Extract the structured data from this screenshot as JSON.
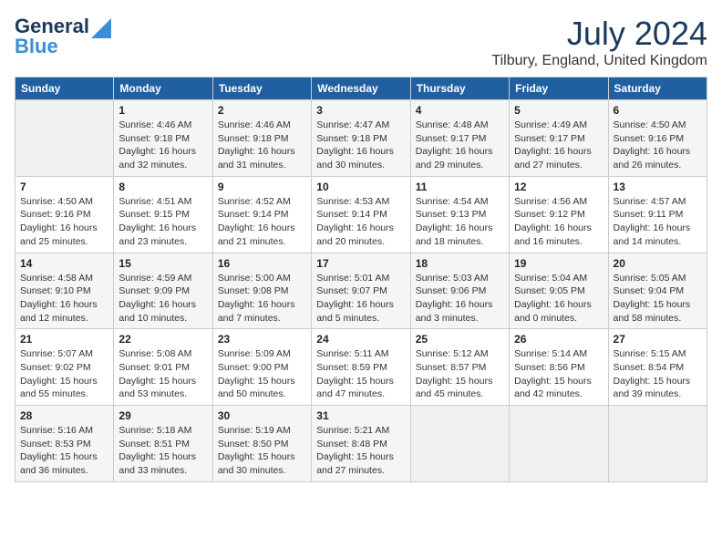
{
  "header": {
    "logo_line1": "General",
    "logo_line2": "Blue",
    "month_year": "July 2024",
    "location": "Tilbury, England, United Kingdom"
  },
  "days_of_week": [
    "Sunday",
    "Monday",
    "Tuesday",
    "Wednesday",
    "Thursday",
    "Friday",
    "Saturday"
  ],
  "weeks": [
    [
      {
        "day": "",
        "info": ""
      },
      {
        "day": "1",
        "info": "Sunrise: 4:46 AM\nSunset: 9:18 PM\nDaylight: 16 hours\nand 32 minutes."
      },
      {
        "day": "2",
        "info": "Sunrise: 4:46 AM\nSunset: 9:18 PM\nDaylight: 16 hours\nand 31 minutes."
      },
      {
        "day": "3",
        "info": "Sunrise: 4:47 AM\nSunset: 9:18 PM\nDaylight: 16 hours\nand 30 minutes."
      },
      {
        "day": "4",
        "info": "Sunrise: 4:48 AM\nSunset: 9:17 PM\nDaylight: 16 hours\nand 29 minutes."
      },
      {
        "day": "5",
        "info": "Sunrise: 4:49 AM\nSunset: 9:17 PM\nDaylight: 16 hours\nand 27 minutes."
      },
      {
        "day": "6",
        "info": "Sunrise: 4:50 AM\nSunset: 9:16 PM\nDaylight: 16 hours\nand 26 minutes."
      }
    ],
    [
      {
        "day": "7",
        "info": "Sunrise: 4:50 AM\nSunset: 9:16 PM\nDaylight: 16 hours\nand 25 minutes."
      },
      {
        "day": "8",
        "info": "Sunrise: 4:51 AM\nSunset: 9:15 PM\nDaylight: 16 hours\nand 23 minutes."
      },
      {
        "day": "9",
        "info": "Sunrise: 4:52 AM\nSunset: 9:14 PM\nDaylight: 16 hours\nand 21 minutes."
      },
      {
        "day": "10",
        "info": "Sunrise: 4:53 AM\nSunset: 9:14 PM\nDaylight: 16 hours\nand 20 minutes."
      },
      {
        "day": "11",
        "info": "Sunrise: 4:54 AM\nSunset: 9:13 PM\nDaylight: 16 hours\nand 18 minutes."
      },
      {
        "day": "12",
        "info": "Sunrise: 4:56 AM\nSunset: 9:12 PM\nDaylight: 16 hours\nand 16 minutes."
      },
      {
        "day": "13",
        "info": "Sunrise: 4:57 AM\nSunset: 9:11 PM\nDaylight: 16 hours\nand 14 minutes."
      }
    ],
    [
      {
        "day": "14",
        "info": "Sunrise: 4:58 AM\nSunset: 9:10 PM\nDaylight: 16 hours\nand 12 minutes."
      },
      {
        "day": "15",
        "info": "Sunrise: 4:59 AM\nSunset: 9:09 PM\nDaylight: 16 hours\nand 10 minutes."
      },
      {
        "day": "16",
        "info": "Sunrise: 5:00 AM\nSunset: 9:08 PM\nDaylight: 16 hours\nand 7 minutes."
      },
      {
        "day": "17",
        "info": "Sunrise: 5:01 AM\nSunset: 9:07 PM\nDaylight: 16 hours\nand 5 minutes."
      },
      {
        "day": "18",
        "info": "Sunrise: 5:03 AM\nSunset: 9:06 PM\nDaylight: 16 hours\nand 3 minutes."
      },
      {
        "day": "19",
        "info": "Sunrise: 5:04 AM\nSunset: 9:05 PM\nDaylight: 16 hours\nand 0 minutes."
      },
      {
        "day": "20",
        "info": "Sunrise: 5:05 AM\nSunset: 9:04 PM\nDaylight: 15 hours\nand 58 minutes."
      }
    ],
    [
      {
        "day": "21",
        "info": "Sunrise: 5:07 AM\nSunset: 9:02 PM\nDaylight: 15 hours\nand 55 minutes."
      },
      {
        "day": "22",
        "info": "Sunrise: 5:08 AM\nSunset: 9:01 PM\nDaylight: 15 hours\nand 53 minutes."
      },
      {
        "day": "23",
        "info": "Sunrise: 5:09 AM\nSunset: 9:00 PM\nDaylight: 15 hours\nand 50 minutes."
      },
      {
        "day": "24",
        "info": "Sunrise: 5:11 AM\nSunset: 8:59 PM\nDaylight: 15 hours\nand 47 minutes."
      },
      {
        "day": "25",
        "info": "Sunrise: 5:12 AM\nSunset: 8:57 PM\nDaylight: 15 hours\nand 45 minutes."
      },
      {
        "day": "26",
        "info": "Sunrise: 5:14 AM\nSunset: 8:56 PM\nDaylight: 15 hours\nand 42 minutes."
      },
      {
        "day": "27",
        "info": "Sunrise: 5:15 AM\nSunset: 8:54 PM\nDaylight: 15 hours\nand 39 minutes."
      }
    ],
    [
      {
        "day": "28",
        "info": "Sunrise: 5:16 AM\nSunset: 8:53 PM\nDaylight: 15 hours\nand 36 minutes."
      },
      {
        "day": "29",
        "info": "Sunrise: 5:18 AM\nSunset: 8:51 PM\nDaylight: 15 hours\nand 33 minutes."
      },
      {
        "day": "30",
        "info": "Sunrise: 5:19 AM\nSunset: 8:50 PM\nDaylight: 15 hours\nand 30 minutes."
      },
      {
        "day": "31",
        "info": "Sunrise: 5:21 AM\nSunset: 8:48 PM\nDaylight: 15 hours\nand 27 minutes."
      },
      {
        "day": "",
        "info": ""
      },
      {
        "day": "",
        "info": ""
      },
      {
        "day": "",
        "info": ""
      }
    ]
  ]
}
